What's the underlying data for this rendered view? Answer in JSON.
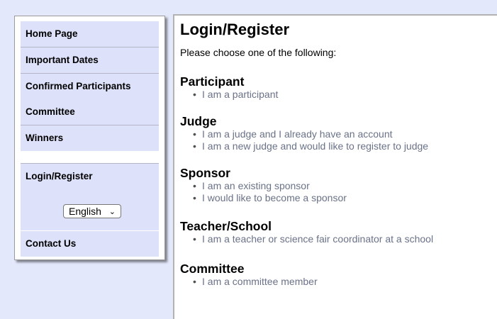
{
  "sidebar": {
    "nav_items": [
      {
        "label": "Home Page"
      },
      {
        "label": "Important Dates"
      },
      {
        "label": "Confirmed Participants"
      },
      {
        "label": "Committee"
      },
      {
        "label": "Winners"
      },
      {
        "label": "Login/Register"
      },
      {
        "label": "Contact Us"
      }
    ],
    "language_selected": "English"
  },
  "main": {
    "title": "Login/Register",
    "intro": "Please choose one of the following:",
    "sections": [
      {
        "heading": "Participant",
        "links": [
          "I am a participant"
        ]
      },
      {
        "heading": "Judge",
        "links": [
          "I am a judge and I already have an account",
          "I am a new judge and would like to register to judge"
        ]
      },
      {
        "heading": "Sponsor",
        "links": [
          "I am an existing sponsor",
          "I would like to become a sponsor"
        ]
      },
      {
        "heading": "Teacher/School",
        "links": [
          "I am a teacher or science fair coordinator at a school"
        ]
      },
      {
        "heading": "Committee",
        "links": [
          "I am a committee member"
        ]
      }
    ]
  },
  "colors": {
    "page_bg": "#e4e8fb",
    "nav_bg": "#dde1f9",
    "link": "#6a7288"
  }
}
